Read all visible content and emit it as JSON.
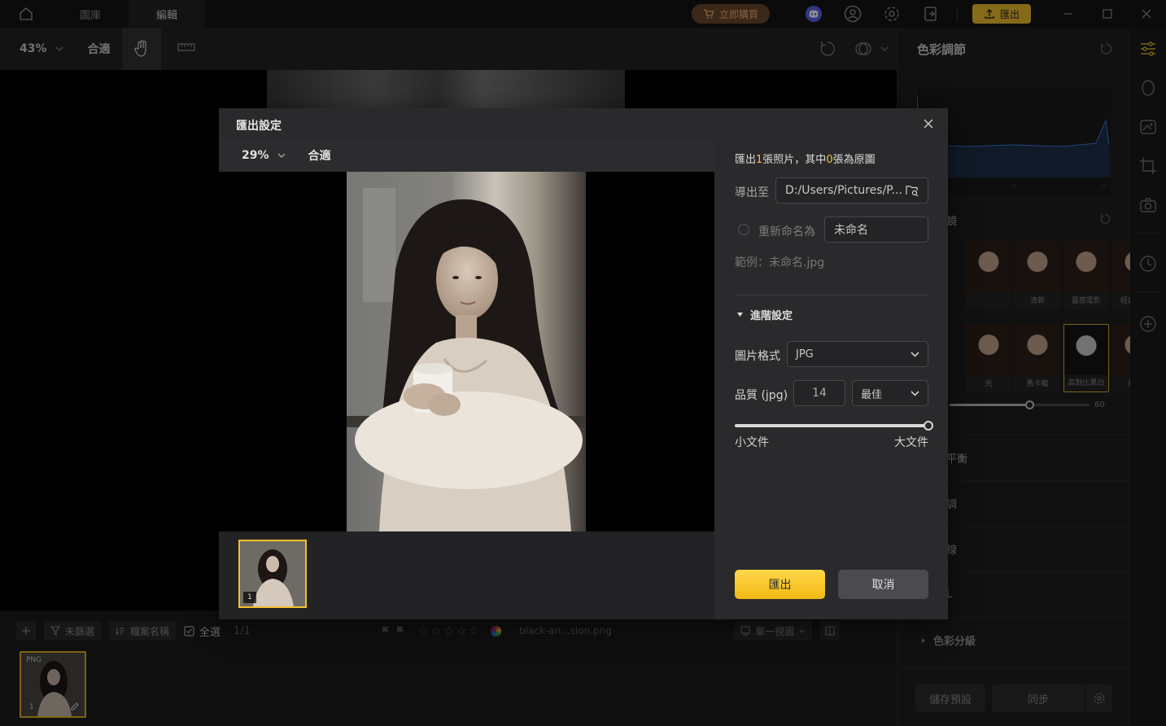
{
  "titlebar": {
    "tabs": [
      {
        "label": "圖庫",
        "active": false
      },
      {
        "label": "編輯",
        "active": true
      }
    ],
    "buy_label": "立即購買",
    "export_label": "匯出",
    "accent": "#f2c12e"
  },
  "toolbar": {
    "zoom": "43%",
    "fit": "合適"
  },
  "filmbar": {
    "filter_label": "未篩選",
    "sort_label": "檔案名稱",
    "select_all_label": "全選",
    "count": "1/1",
    "filename": "black-an...sion.png",
    "view_label": "單一視圖",
    "thumb_type": "PNG",
    "thumb_index": "1"
  },
  "right_panel": {
    "title": "色彩調節",
    "histo_labels": [
      "--",
      "--"
    ],
    "filter_section": "鏡",
    "filter_row1": [
      "",
      "清新",
      "靈感電影",
      "經典旅拍"
    ],
    "filter_row2": [
      "光",
      "馬卡龍",
      "高對比黑白",
      "更多"
    ],
    "slider_value": "60",
    "sections": [
      "平衡",
      "調",
      "線",
      "L",
      "色彩分級"
    ],
    "save_preset_label": "儲存預設",
    "sync_label": "同步"
  },
  "dialog": {
    "title": "匯出設定",
    "zoom": "29%",
    "fit": "合適",
    "thumb_index": "1",
    "info_prefix": "匯出",
    "info_count": "1",
    "info_mid": "張照片，其中",
    "info_original": "0",
    "info_suffix": "張為原圖",
    "export_to_label": "導出至",
    "export_path": "D:/Users/Pictures/P...",
    "rename_label": "重新命名為",
    "rename_value": "未命名",
    "example_label": "範例：未命名.jpg",
    "advanced_label": "進階設定",
    "format_label": "圖片格式",
    "format_value": "JPG",
    "quality_label": "品質 (jpg)",
    "quality_value": "14",
    "quality_preset": "最佳",
    "quality_slider": 1.0,
    "small_label": "小文件",
    "large_label": "大文件",
    "export_button": "匯出",
    "cancel_button": "取消"
  }
}
